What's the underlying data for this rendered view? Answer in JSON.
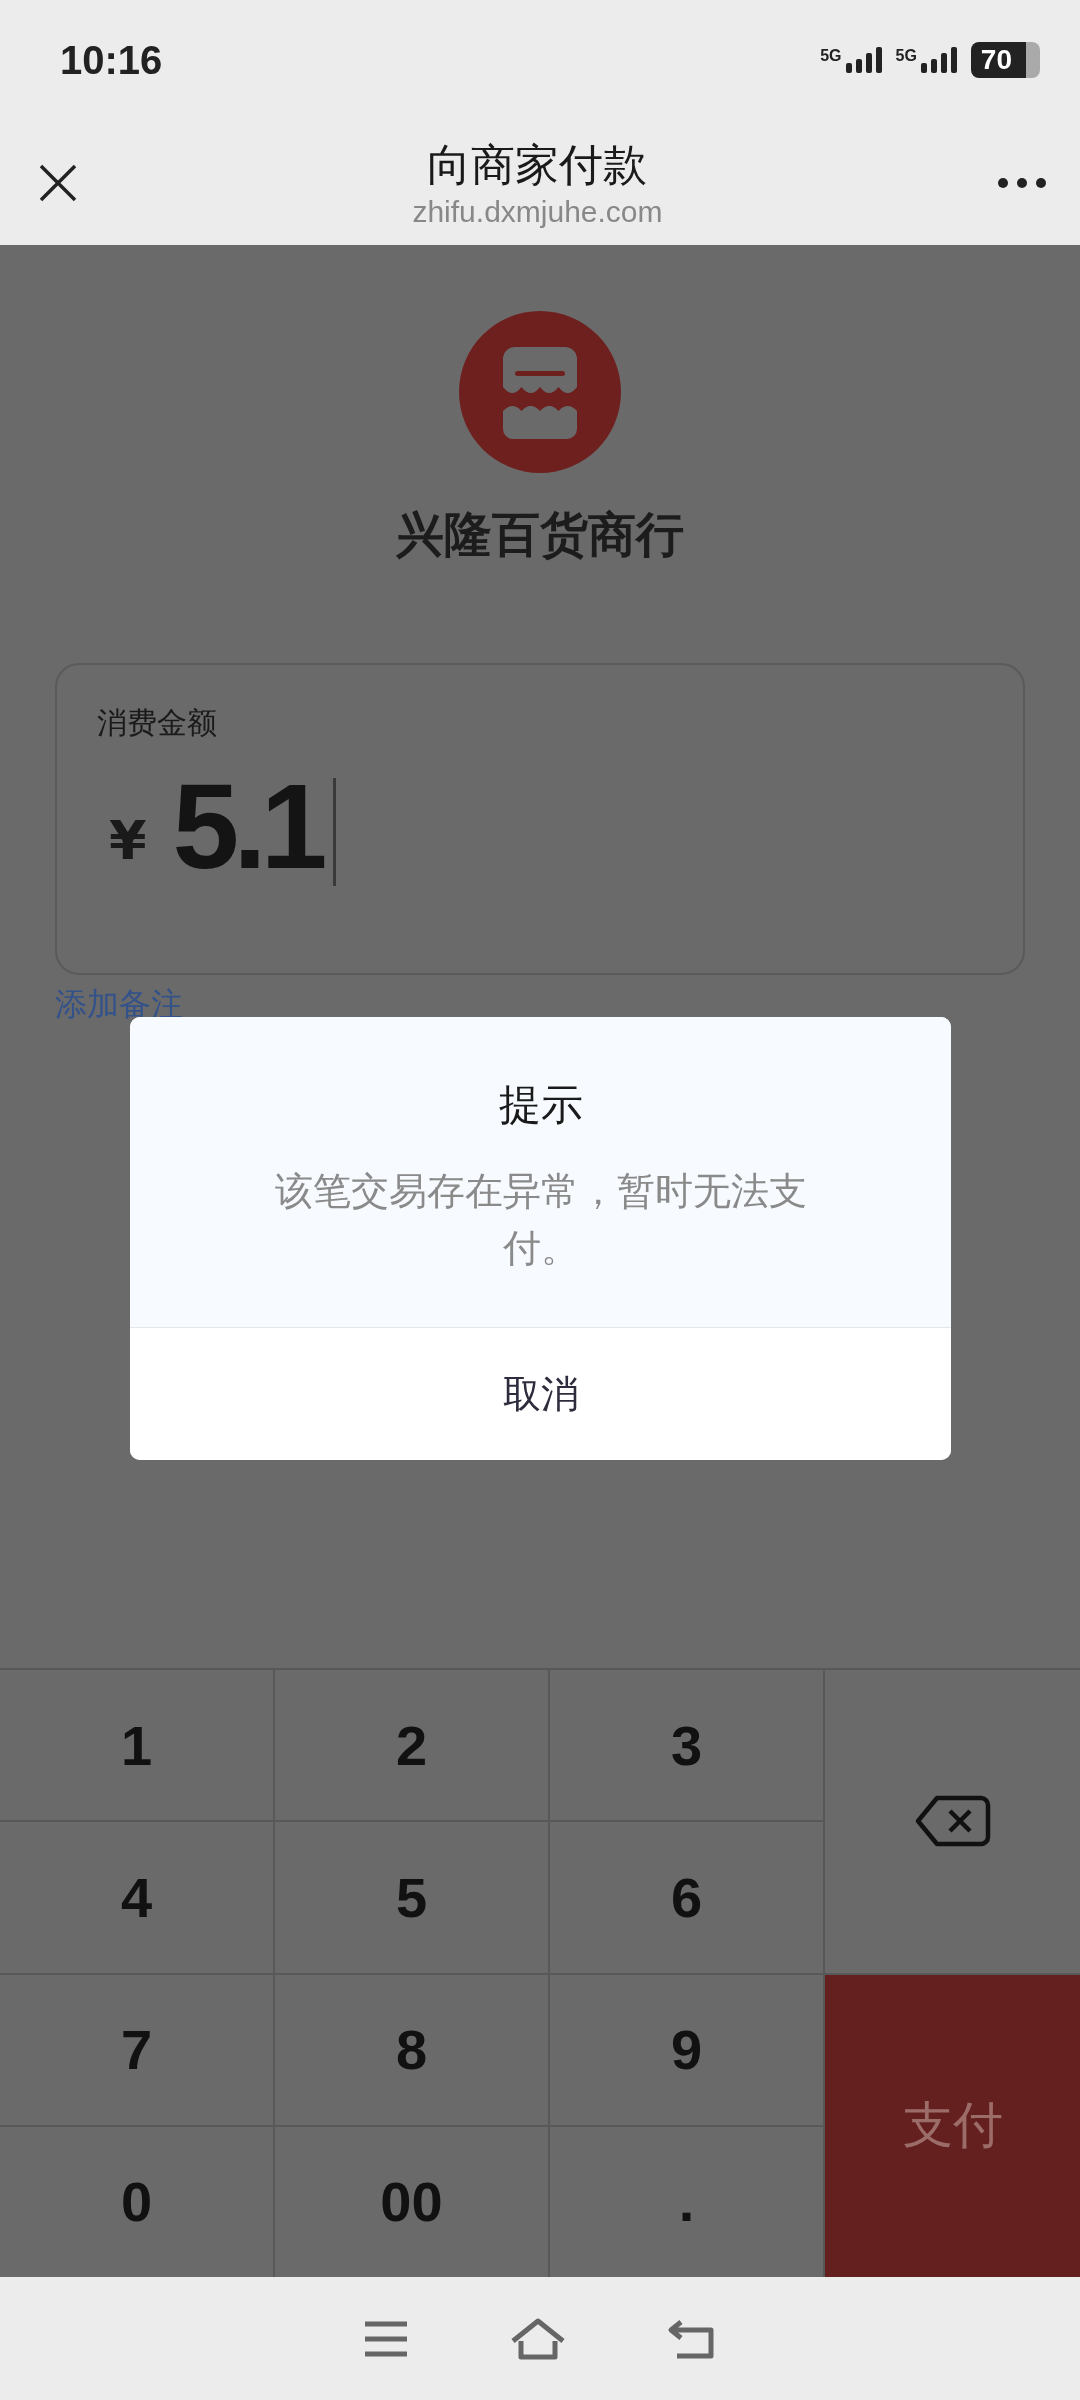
{
  "status_bar": {
    "time": "10:16",
    "network_1": "5G",
    "network_2": "5G",
    "battery": "70"
  },
  "header": {
    "title": "向商家付款",
    "url": "zhifu.dxmjuhe.com"
  },
  "merchant": {
    "name": "兴隆百货商行"
  },
  "amount": {
    "label": "消费金额",
    "currency": "¥",
    "value": "5.1"
  },
  "add_note_link": "添加备注",
  "dialog": {
    "title": "提示",
    "message": "该笔交易存在异常，暂时无法支付。",
    "button": "取消"
  },
  "keypad": {
    "keys": [
      {
        "label": "1"
      },
      {
        "label": "2"
      },
      {
        "label": "3"
      },
      {
        "label": "4"
      },
      {
        "label": "5"
      },
      {
        "label": "6"
      },
      {
        "label": "7"
      },
      {
        "label": "8"
      },
      {
        "label": "9"
      },
      {
        "label": "0"
      },
      {
        "label": "00"
      },
      {
        "label": "."
      }
    ],
    "pay_button": "支付"
  }
}
